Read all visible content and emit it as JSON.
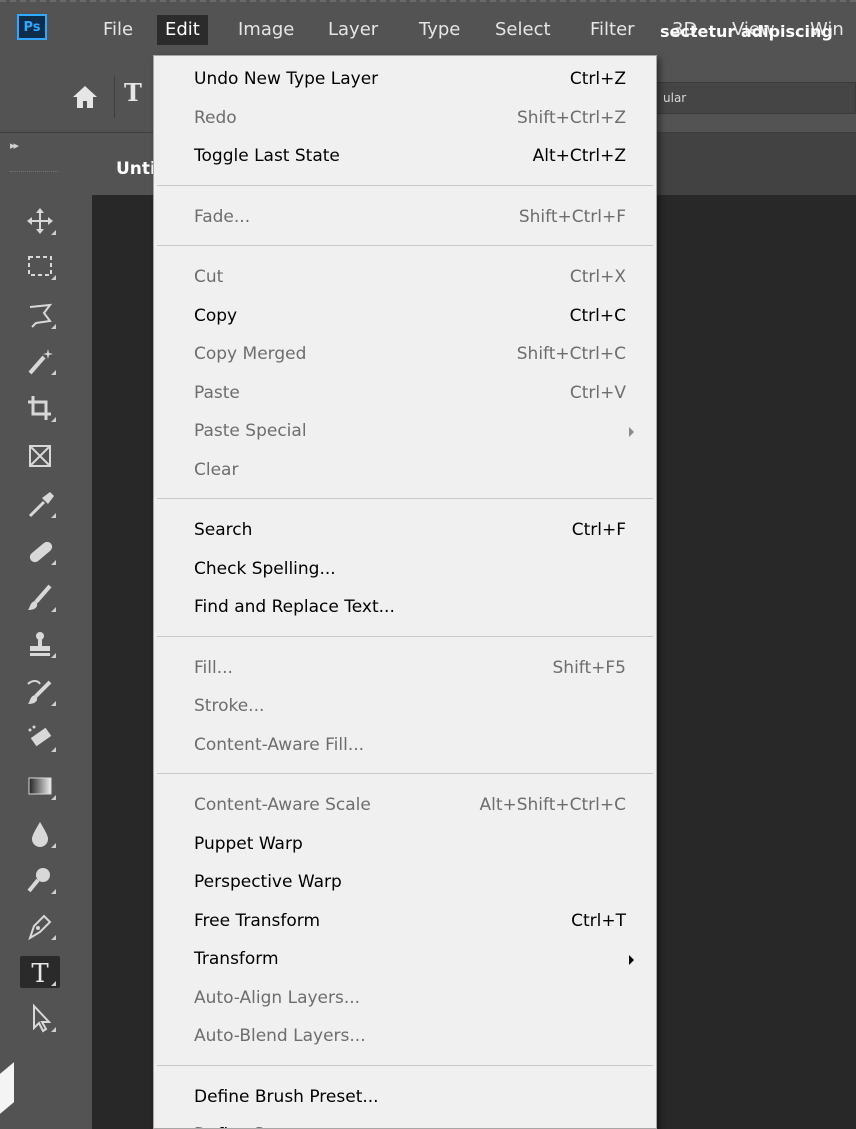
{
  "app": {
    "logo": "Ps"
  },
  "menubar": {
    "items": [
      "File",
      "Edit",
      "Image",
      "Layer",
      "Type",
      "Select",
      "Filter",
      "3D",
      "View",
      "Win"
    ],
    "active": "Edit"
  },
  "options_bar": {
    "home_icon": "home-icon",
    "tool_indicator": "T",
    "font_style_value": "ular"
  },
  "document": {
    "tab_title": "Unti",
    "visible_text": "sectetur adipiscing"
  },
  "toolbar": {
    "collapse_glyph": "▸▸",
    "tools": [
      {
        "name": "move-tool-icon"
      },
      {
        "name": "marquee-tool-icon"
      },
      {
        "name": "lasso-tool-icon"
      },
      {
        "name": "magic-wand-tool-icon"
      },
      {
        "name": "crop-tool-icon"
      },
      {
        "name": "frame-tool-icon"
      },
      {
        "name": "eyedropper-tool-icon"
      },
      {
        "name": "healing-brush-tool-icon"
      },
      {
        "name": "brush-tool-icon"
      },
      {
        "name": "clone-stamp-tool-icon"
      },
      {
        "name": "history-brush-tool-icon"
      },
      {
        "name": "eraser-tool-icon"
      },
      {
        "name": "gradient-tool-icon"
      },
      {
        "name": "blur-tool-icon"
      },
      {
        "name": "dodge-tool-icon"
      },
      {
        "name": "pen-tool-icon"
      },
      {
        "name": "type-tool-icon"
      },
      {
        "name": "path-selection-tool-icon"
      }
    ],
    "selected_tool": "type-tool-icon"
  },
  "edit_menu": {
    "items": [
      {
        "label": "Undo New Type Layer",
        "shortcut": "Ctrl+Z",
        "enabled": true
      },
      {
        "label": "Redo",
        "shortcut": "Shift+Ctrl+Z",
        "enabled": false
      },
      {
        "label": "Toggle Last State",
        "shortcut": "Alt+Ctrl+Z",
        "enabled": true
      },
      {
        "separator": true
      },
      {
        "label": "Fade...",
        "shortcut": "Shift+Ctrl+F",
        "enabled": false
      },
      {
        "separator": true
      },
      {
        "label": "Cut",
        "shortcut": "Ctrl+X",
        "enabled": false
      },
      {
        "label": "Copy",
        "shortcut": "Ctrl+C",
        "enabled": true
      },
      {
        "label": "Copy Merged",
        "shortcut": "Shift+Ctrl+C",
        "enabled": false
      },
      {
        "label": "Paste",
        "shortcut": "Ctrl+V",
        "enabled": false
      },
      {
        "label": "Paste Special",
        "shortcut": "",
        "enabled": false,
        "submenu": true
      },
      {
        "label": "Clear",
        "shortcut": "",
        "enabled": false
      },
      {
        "separator": true
      },
      {
        "label": "Search",
        "shortcut": "Ctrl+F",
        "enabled": true
      },
      {
        "label": "Check Spelling...",
        "shortcut": "",
        "enabled": true
      },
      {
        "label": "Find and Replace Text...",
        "shortcut": "",
        "enabled": true
      },
      {
        "separator": true
      },
      {
        "label": "Fill...",
        "shortcut": "Shift+F5",
        "enabled": false
      },
      {
        "label": "Stroke...",
        "shortcut": "",
        "enabled": false
      },
      {
        "label": "Content-Aware Fill...",
        "shortcut": "",
        "enabled": false
      },
      {
        "separator": true
      },
      {
        "label": "Content-Aware Scale",
        "shortcut": "Alt+Shift+Ctrl+C",
        "enabled": false
      },
      {
        "label": "Puppet Warp",
        "shortcut": "",
        "enabled": true
      },
      {
        "label": "Perspective Warp",
        "shortcut": "",
        "enabled": true
      },
      {
        "label": "Free Transform",
        "shortcut": "Ctrl+T",
        "enabled": true
      },
      {
        "label": "Transform",
        "shortcut": "",
        "enabled": true,
        "submenu": true
      },
      {
        "label": "Auto-Align Layers...",
        "shortcut": "",
        "enabled": false
      },
      {
        "label": "Auto-Blend Layers...",
        "shortcut": "",
        "enabled": false
      },
      {
        "separator": true
      },
      {
        "label": "Define Brush Preset...",
        "shortcut": "",
        "enabled": true
      },
      {
        "label": "Define Pattern...",
        "shortcut": "",
        "enabled": true
      }
    ]
  },
  "colors": {
    "ui_dark": "#535353",
    "canvas": "#282828",
    "menu_bg": "#f0f0f0",
    "menu_text_enabled": "#000000",
    "menu_text_disabled": "#6d6d6d",
    "ps_blue": "#31a8ff"
  }
}
